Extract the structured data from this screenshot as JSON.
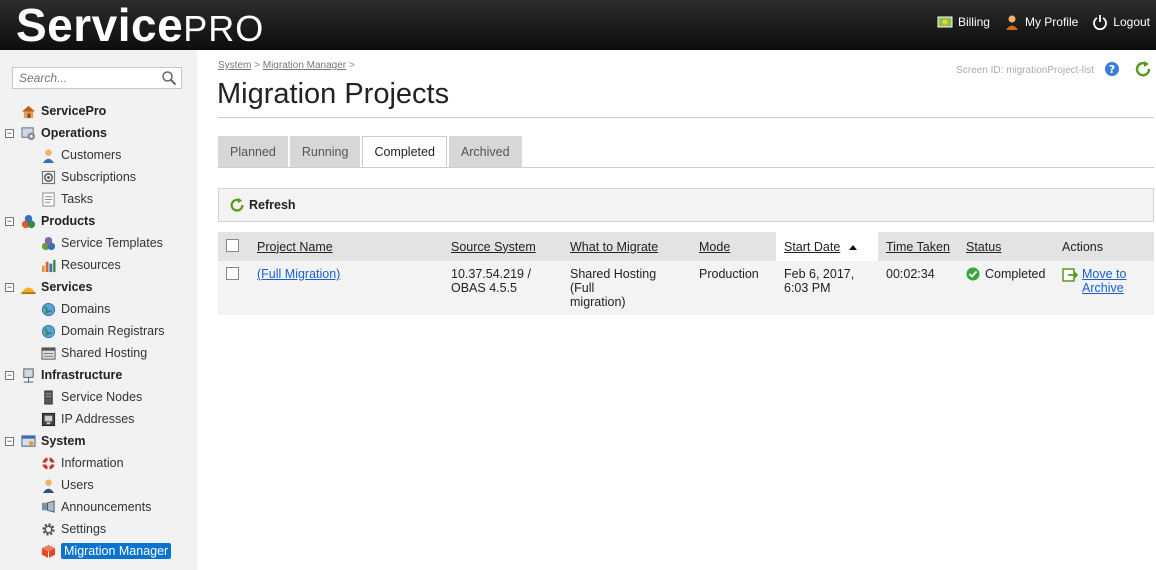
{
  "header": {
    "logo_bold": "Service",
    "logo_light": "PRO",
    "links": [
      {
        "label": "Billing",
        "icon": "billing-icon"
      },
      {
        "label": "My Profile",
        "icon": "user-icon"
      },
      {
        "label": "Logout",
        "icon": "power-icon"
      }
    ]
  },
  "sidebar": {
    "search_placeholder": "Search...",
    "root": "ServicePro",
    "groups": [
      {
        "label": "Operations",
        "items": [
          "Customers",
          "Subscriptions",
          "Tasks"
        ]
      },
      {
        "label": "Products",
        "items": [
          "Service Templates",
          "Resources"
        ]
      },
      {
        "label": "Services",
        "items": [
          "Domains",
          "Domain Registrars",
          "Shared Hosting"
        ]
      },
      {
        "label": "Infrastructure",
        "items": [
          "Service Nodes",
          "IP Addresses"
        ]
      },
      {
        "label": "System",
        "items": [
          "Information",
          "Users",
          "Announcements",
          "Settings",
          "Migration Manager"
        ]
      }
    ],
    "active_item": "Migration Manager"
  },
  "breadcrumb": [
    "System",
    "Migration Manager"
  ],
  "screen_id_label": "Screen ID:",
  "screen_id": "migrationProject-list",
  "page_title": "Migration Projects",
  "tabs": [
    "Planned",
    "Running",
    "Completed",
    "Archived"
  ],
  "selected_tab": "Completed",
  "toolbar": {
    "refresh_label": "Refresh"
  },
  "table": {
    "columns": [
      "Project Name",
      "Source System",
      "What to Migrate",
      "Mode",
      "Start Date",
      "Time Taken",
      "Status",
      "Actions"
    ],
    "sorted_column": "Start Date",
    "rows": [
      {
        "project_name": "(Full Migration)",
        "source_system_1": "10.37.54.219 /",
        "source_system_2": "OBAS 4.5.5",
        "what_1": "Shared Hosting (Full",
        "what_2": "migration)",
        "mode": "Production",
        "start_1": "Feb 6, 2017,",
        "start_2": "6:03 PM",
        "time_taken": "00:02:34",
        "status": "Completed",
        "action_1": "Move to",
        "action_2": "Archive"
      }
    ]
  },
  "colors": {
    "accent": "#0a73d1",
    "link": "#1a5fd1",
    "status_ok": "#3aa53a",
    "header_bg": "#111111"
  }
}
